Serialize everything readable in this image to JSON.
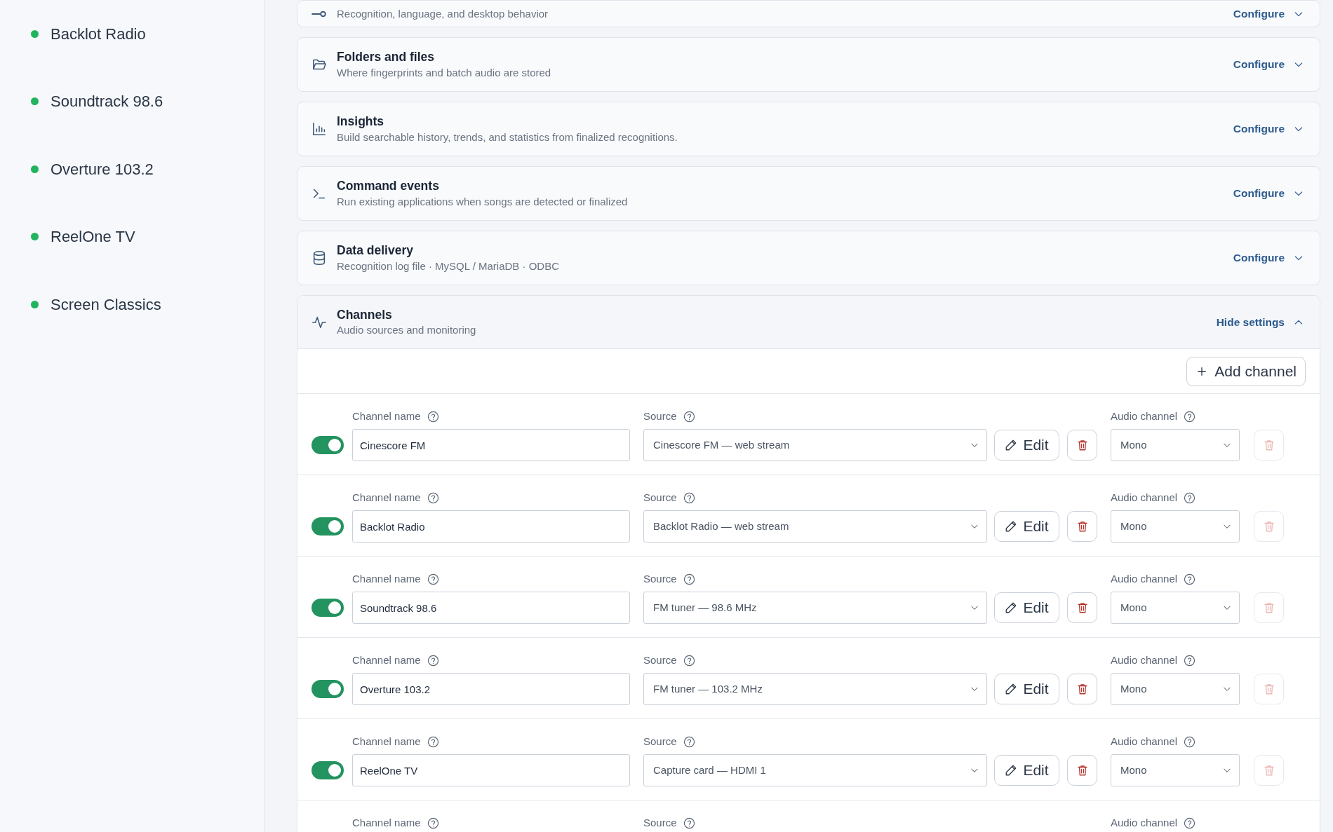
{
  "sidebar": {
    "items": [
      {
        "label": "Backlot Radio",
        "online": true
      },
      {
        "label": "Soundtrack 98.6",
        "online": true
      },
      {
        "label": "Overture 103.2",
        "online": true
      },
      {
        "label": "ReelOne TV",
        "online": true
      },
      {
        "label": "Screen Classics",
        "online": true
      }
    ]
  },
  "sections": [
    {
      "description": "Recognition, language, and desktop behavior",
      "action": "Configure",
      "expanded": false
    },
    {
      "title": "Folders and files",
      "description": "Where fingerprints and batch audio are stored",
      "action": "Configure",
      "expanded": false
    },
    {
      "title": "Insights",
      "description": "Build searchable history, trends, and statistics from finalized recognitions.",
      "action": "Configure",
      "expanded": false
    },
    {
      "title": "Command events",
      "description": "Run existing applications when songs are detected or finalized",
      "action": "Configure",
      "expanded": false
    },
    {
      "title": "Data delivery",
      "description": "Recognition log file · MySQL / MariaDB · ODBC",
      "action": "Configure",
      "expanded": false
    },
    {
      "title": "Channels",
      "description": "Audio sources and monitoring",
      "action": "Hide settings",
      "expanded": true
    }
  ],
  "channels_panel": {
    "add_button": "Add channel",
    "channels": [
      {
        "enabled": true,
        "name_label": "Channel name",
        "name": "Cinescore FM",
        "source_label": "Source",
        "source": "Cinescore FM — web stream",
        "edit": "Edit",
        "audio_label": "Audio channel",
        "audio": "Mono",
        "audio_remove_disabled": true
      },
      {
        "enabled": true,
        "name_label": "Channel name",
        "name": "Backlot Radio",
        "source_label": "Source",
        "source": "Backlot Radio — web stream",
        "edit": "Edit",
        "audio_label": "Audio channel",
        "audio": "Mono",
        "audio_remove_disabled": true
      },
      {
        "enabled": true,
        "name_label": "Channel name",
        "name": "Soundtrack 98.6",
        "source_label": "Source",
        "source": "FM tuner — 98.6 MHz",
        "edit": "Edit",
        "audio_label": "Audio channel",
        "audio": "Mono",
        "audio_remove_disabled": true
      },
      {
        "enabled": true,
        "name_label": "Channel name",
        "name": "Overture 103.2",
        "source_label": "Source",
        "source": "FM tuner — 103.2 MHz",
        "edit": "Edit",
        "audio_label": "Audio channel",
        "audio": "Mono",
        "audio_remove_disabled": true
      },
      {
        "enabled": true,
        "name_label": "Channel name",
        "name": "ReelOne TV",
        "source_label": "Source",
        "source": "Capture card — HDMI 1",
        "edit": "Edit",
        "audio_label": "Audio channel",
        "audio": "Mono",
        "audio_remove_disabled": true
      },
      {
        "name_label": "Channel name",
        "source_label": "Source",
        "audio_label": "Audio channel"
      }
    ]
  }
}
